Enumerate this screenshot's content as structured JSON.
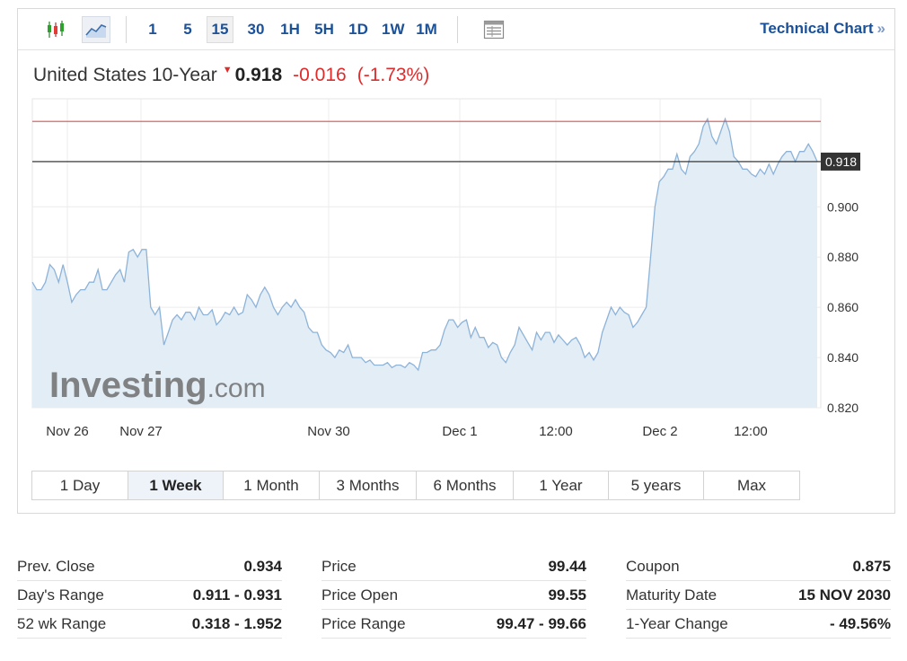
{
  "toolbar": {
    "candles_icon": "candlestick-chart-icon",
    "line_icon": "line-chart-icon",
    "intervals": [
      "1",
      "5",
      "15",
      "30",
      "1H",
      "5H",
      "1D",
      "1W",
      "1M"
    ],
    "active_interval": "15",
    "table_icon": "table-view-icon",
    "tech_chart": "Technical Chart",
    "tech_chev": "»"
  },
  "quote": {
    "name": "United States 10-Year",
    "direction_glyph": "▼",
    "last": "0.918",
    "change": "-0.016",
    "change_pct": "(-1.73%)"
  },
  "chart_data": {
    "type": "area",
    "y_labels": [
      "0.900",
      "0.880",
      "0.860",
      "0.840",
      "0.820"
    ],
    "ylim": [
      0.82,
      0.943
    ],
    "x_labels": [
      "Nov 26",
      "Nov 27",
      "Nov 30",
      "Dec 1",
      "12:00",
      "Dec 2",
      "12:00"
    ],
    "last_value_label": "0.918",
    "last_value": 0.918,
    "prev_close_line": 0.934,
    "watermark": "Investing",
    "watermark_suffix": ".com",
    "series": [
      {
        "values": [
          0.87,
          0.867,
          0.867,
          0.87,
          0.877,
          0.875,
          0.87,
          0.877,
          0.87,
          0.862,
          0.865,
          0.867,
          0.867,
          0.87,
          0.87,
          0.875,
          0.867,
          0.867,
          0.87,
          0.873,
          0.875,
          0.87,
          0.882,
          0.883,
          0.88,
          0.883,
          0.883,
          0.86,
          0.857,
          0.86,
          0.845,
          0.85,
          0.855,
          0.857,
          0.855,
          0.858,
          0.858,
          0.855,
          0.86,
          0.857,
          0.857,
          0.859,
          0.853,
          0.855,
          0.858,
          0.857,
          0.86,
          0.857,
          0.858,
          0.865,
          0.863,
          0.86,
          0.865,
          0.868,
          0.865,
          0.86,
          0.857,
          0.86,
          0.862,
          0.86,
          0.863,
          0.86,
          0.858,
          0.852,
          0.85,
          0.85,
          0.845,
          0.843,
          0.842,
          0.84,
          0.843,
          0.842,
          0.845,
          0.84,
          0.84,
          0.84,
          0.838,
          0.839,
          0.837,
          0.837,
          0.837,
          0.838,
          0.836,
          0.837,
          0.837,
          0.836,
          0.838,
          0.837,
          0.835,
          0.842,
          0.842,
          0.843,
          0.843,
          0.845,
          0.851,
          0.855,
          0.855,
          0.852,
          0.854,
          0.855,
          0.848,
          0.852,
          0.848,
          0.848,
          0.844,
          0.846,
          0.845,
          0.84,
          0.838,
          0.842,
          0.845,
          0.852,
          0.849,
          0.846,
          0.843,
          0.85,
          0.847,
          0.85,
          0.85,
          0.846,
          0.849,
          0.847,
          0.845,
          0.847,
          0.848,
          0.845,
          0.84,
          0.842,
          0.839,
          0.842,
          0.85,
          0.855,
          0.86,
          0.857,
          0.86,
          0.858,
          0.857,
          0.852,
          0.854,
          0.857,
          0.86,
          0.88,
          0.9,
          0.91,
          0.912,
          0.915,
          0.915,
          0.921,
          0.915,
          0.913,
          0.92,
          0.922,
          0.925,
          0.932,
          0.935,
          0.928,
          0.925,
          0.93,
          0.935,
          0.93,
          0.92,
          0.918,
          0.915,
          0.915,
          0.913,
          0.912,
          0.915,
          0.913,
          0.917,
          0.913,
          0.917,
          0.92,
          0.922,
          0.922,
          0.918,
          0.922,
          0.922,
          0.925,
          0.922,
          0.918
        ]
      }
    ]
  },
  "ranges": [
    "1 Day",
    "1 Week",
    "1 Month",
    "3 Months",
    "6 Months",
    "1 Year",
    "5 years",
    "Max"
  ],
  "active_range": "1 Week",
  "stats": [
    [
      {
        "k": "Prev. Close",
        "v": "0.934"
      },
      {
        "k": "Day's Range",
        "v": "0.911 - 0.931"
      },
      {
        "k": "52 wk Range",
        "v": "0.318 - 1.952"
      }
    ],
    [
      {
        "k": "Price",
        "v": "99.44"
      },
      {
        "k": "Price Open",
        "v": "99.55"
      },
      {
        "k": "Price Range",
        "v": "99.47 - 99.66"
      }
    ],
    [
      {
        "k": "Coupon",
        "v": "0.875"
      },
      {
        "k": "Maturity Date",
        "v": "15 NOV 2030"
      },
      {
        "k": "1-Year Change",
        "v": "- 49.56%"
      }
    ]
  ],
  "colors": {
    "accent": "#1a5199",
    "down": "#e02b2b",
    "line": "#8db3d9",
    "fill": "#e3edf6",
    "prev_close_line": "#d9534f"
  }
}
